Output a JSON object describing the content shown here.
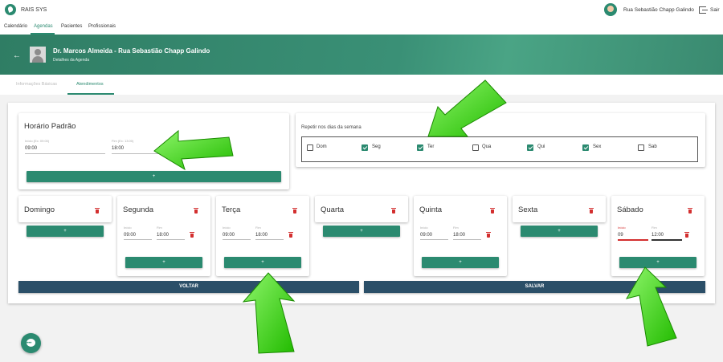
{
  "app": {
    "name": "RAIS SYS"
  },
  "user": {
    "name": "Rua Sebastião Chapp Galindo",
    "logout_label": "Sair"
  },
  "nav": {
    "items": [
      "Calendário",
      "Agendas",
      "Pacientes",
      "Profissionais"
    ],
    "active": "Agendas"
  },
  "header": {
    "title": "Dr. Marcos Almeida - Rua Sebastião Chapp Galindo",
    "subtitle": "Detalhes da Agenda",
    "back_icon": "arrow-left-icon"
  },
  "tabs": [
    {
      "label": "Informações Básicas",
      "active": false
    },
    {
      "label": "Atendimentos",
      "active": true
    }
  ],
  "horario_padrao": {
    "title": "Horário Padrão",
    "start_label": "Início (Ex: 09:00)",
    "start_value": "09:00",
    "end_label": "Fim (Ex: 13:00)",
    "end_value": "18:00",
    "add_label": "+"
  },
  "repeat": {
    "label": "Repetir nos dias da semana",
    "days": [
      {
        "label": "Dom",
        "checked": false
      },
      {
        "label": "Seg",
        "checked": true
      },
      {
        "label": "Ter",
        "checked": true
      },
      {
        "label": "Qua",
        "checked": false
      },
      {
        "label": "Qui",
        "checked": true
      },
      {
        "label": "Sex",
        "checked": true
      },
      {
        "label": "Sab",
        "checked": false
      }
    ]
  },
  "days": [
    {
      "name": "Domingo",
      "add_label": "+"
    },
    {
      "name": "Segunda",
      "start_label": "Início",
      "start_value": "09:00",
      "end_label": "Fim",
      "end_value": "18:00",
      "add_label": "+"
    },
    {
      "name": "Terça",
      "start_label": "Início",
      "start_value": "09:00",
      "end_label": "Fim",
      "end_value": "18:00",
      "add_label": "+"
    },
    {
      "name": "Quarta",
      "add_label": "+"
    },
    {
      "name": "Quinta",
      "start_label": "Início",
      "start_value": "09:00",
      "end_label": "Fim",
      "end_value": "18:00",
      "add_label": "+"
    },
    {
      "name": "Sexta",
      "add_label": "+"
    },
    {
      "name": "Sábado",
      "start_label": "Início",
      "start_value": "09",
      "end_label": "Fim",
      "end_value": "12:00",
      "add_label": "+"
    }
  ],
  "actions": {
    "back_label": "VOLTAR",
    "save_label": "SALVAR"
  },
  "colors": {
    "primary": "#2b8a70",
    "dark_button": "#2b4f68",
    "danger": "#d32f2f",
    "annotation_arrow": "#33cc11"
  }
}
